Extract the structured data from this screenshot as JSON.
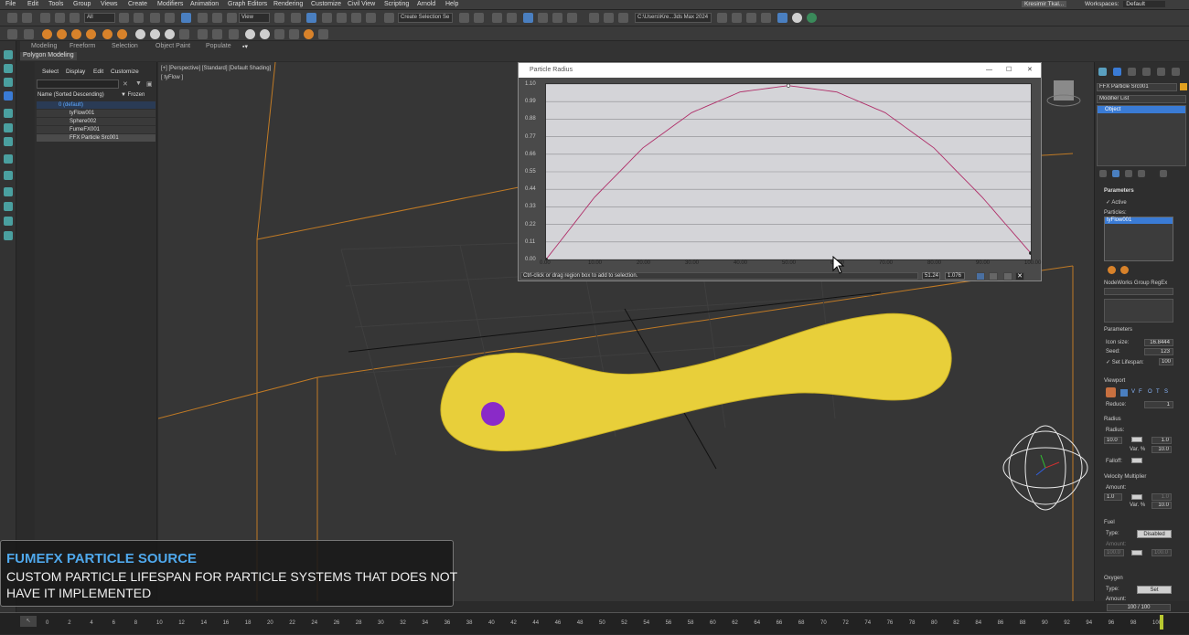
{
  "menu": [
    "File",
    "Edit",
    "Tools",
    "Group",
    "Views",
    "Create",
    "Modifiers",
    "Animation",
    "Graph Editors",
    "Rendering",
    "Customize",
    "Civil View",
    "Scripting",
    "Arnold",
    "Help"
  ],
  "user": "Kresimir Tkal...",
  "workspaces_label": "Workspaces:",
  "workspaces_value": "Default",
  "toolbar": {
    "filter_value": "All",
    "view_value": "View",
    "selection_set": "Create Selection Se",
    "path": "C:\\Users\\Kre...3ds Max 2024"
  },
  "ribbon": {
    "tabs": [
      "Modeling",
      "Freeform",
      "Selection",
      "Object Paint",
      "Populate"
    ],
    "subtab": "Polygon Modeling"
  },
  "scene_explorer": {
    "tabs": [
      "Select",
      "Display",
      "Edit",
      "Customize"
    ],
    "header_name": "Name (Sorted Descending)",
    "header_frozen": "▼ Frozen",
    "rows": [
      "0 (default)",
      "tyFlow001",
      "Sphere002",
      "FumeFX001",
      "FFX Particle Src001"
    ]
  },
  "viewport": {
    "label": "[+] [Perspective] [Standard] [Default Shading]",
    "object_label": "[ tyFlow ]"
  },
  "dialog": {
    "title": "Particle Radius",
    "status": "Ctrl-click or drag region box to add to selection.",
    "field1": "51.24",
    "field2": "1.076",
    "y_ticks": [
      "1.10",
      "0.99",
      "0.88",
      "0.77",
      "0.66",
      "0.55",
      "0.44",
      "0.33",
      "0.22",
      "0.11",
      "0.00"
    ],
    "x_ticks": [
      "0.00",
      "10.00",
      "20.00",
      "30.00",
      "40.00",
      "50.00",
      "60.00",
      "70.00",
      "80.00",
      "90.00",
      "100.00"
    ]
  },
  "chart_data": {
    "type": "line",
    "x": [
      0,
      10,
      20,
      30,
      40,
      50,
      60,
      70,
      80,
      90,
      100
    ],
    "series": [
      {
        "values": [
          0.0,
          0.39,
          0.7,
          0.92,
          1.05,
          1.09,
          1.05,
          0.92,
          0.7,
          0.39,
          0.04
        ]
      }
    ],
    "xlim": [
      0,
      100
    ],
    "ylim": [
      0,
      1.1
    ],
    "grid": true
  },
  "right_panel": {
    "object_name": "FFX Particle Src001",
    "modifier_list": "Modifier List",
    "stack_item": "Object",
    "parameters_title": "Parameters",
    "active_label": "Active",
    "particles_label": "Particles:",
    "particles_item": "tyFlow001",
    "nodeworks_label": "NodeWorks Group RegEx",
    "params2_title": "Parameters",
    "icon_size_label": "Icon size:",
    "icon_size_value": "16.8444",
    "seed_label": "Seed:",
    "seed_value": "123",
    "set_lifespan_label": "Set Lifespan:",
    "set_lifespan_value": "100",
    "viewport_title": "Viewport",
    "viewport_buttons": [
      "V",
      "F",
      "O",
      "T",
      "S"
    ],
    "reduce_label": "Reduce:",
    "reduce_value": "1",
    "radius_title": "Radius",
    "radius_label": "Radius:",
    "radius_value": "10.0",
    "radius_mult": "1.0",
    "var_label": "Var. %",
    "var_value": "10.0",
    "falloff_label": "Falloff:",
    "vel_title": "Velocity Multiplier",
    "amount_label": "Amount:",
    "amount_value": "1.0",
    "amount_mult": "1.0",
    "vel_var_value": "10.0",
    "fuel_title": "Fuel",
    "type_label": "Type:",
    "fuel_type": "Disabled",
    "fuel_amount_label": "Amount:",
    "fuel_amount_value": "100.0",
    "fuel_amount_mult": "100.0",
    "oxygen_title": "Oxygen",
    "oxygen_type": "Set",
    "oxygen_amount_label": "Amount:",
    "frame_counter": "100 / 100"
  },
  "timeline": {
    "ticks": [
      "0",
      "2",
      "4",
      "6",
      "8",
      "10",
      "12",
      "14",
      "16",
      "18",
      "20",
      "22",
      "24",
      "26",
      "28",
      "30",
      "32",
      "34",
      "36",
      "38",
      "40",
      "42",
      "44",
      "46",
      "48",
      "50",
      "52",
      "54",
      "56",
      "58",
      "60",
      "62",
      "64",
      "66",
      "68",
      "70",
      "72",
      "74",
      "76",
      "78",
      "80",
      "82",
      "84",
      "86",
      "88",
      "90",
      "92",
      "94",
      "96",
      "98",
      "100"
    ]
  },
  "overlay": {
    "title": "FUMEFX PARTICLE SOURCE",
    "line1": "CUSTOM PARTICLE LIFESPAN FOR PARTICLE SYSTEMS THAT DOES NOT",
    "line2": "HAVE IT IMPLEMENTED"
  },
  "colors": {
    "curve": "#b0306a",
    "accent": "#3a7bd5",
    "overlay_title": "#4fa8ec",
    "particles": "#e8cf3a",
    "sphere": "#8a2ac8"
  }
}
